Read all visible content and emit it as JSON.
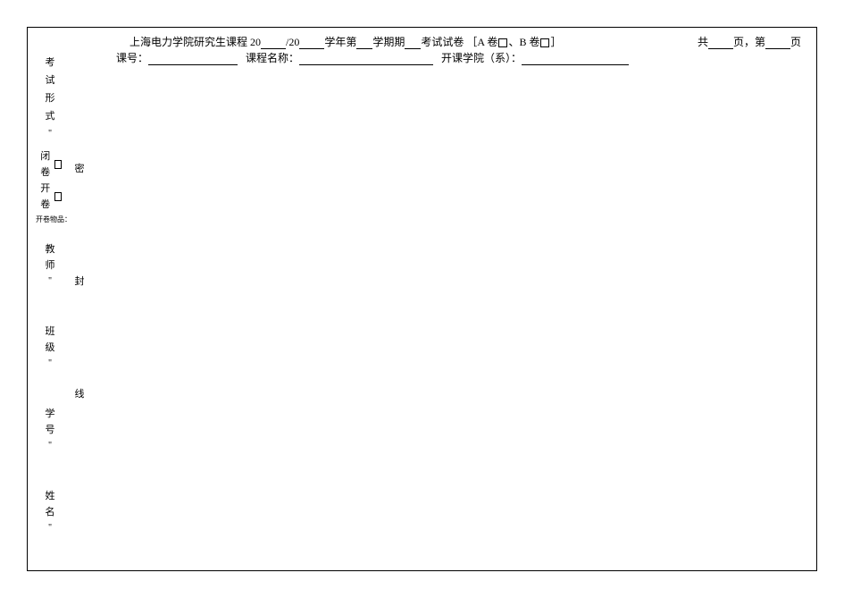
{
  "header": {
    "title_prefix": "上海电力学院研究生课程 20",
    "title_mid1": "/20",
    "title_mid2": "学年第",
    "title_mid3": "学期期",
    "title_suffix": "考试试卷",
    "bracket_open": "［",
    "a_paper": "A 卷",
    "separator": "、",
    "b_paper": "B 卷",
    "bracket_close": "］"
  },
  "page_info": {
    "total_prefix": "共",
    "total_suffix": "页，第",
    "current_suffix": "页"
  },
  "sub_header": {
    "course_no_label": "课号：",
    "course_name_label": "课程名称：",
    "dept_label": "开课学院（系）："
  },
  "left": {
    "exam_form": {
      "c1": "考",
      "c2": "试",
      "c3": "形",
      "c4": "式"
    },
    "closed": "闭卷",
    "open": "开卷",
    "items": "开卷物品：",
    "teacher": {
      "c1": "教",
      "c2": "师"
    },
    "class": {
      "c1": "班",
      "c2": "级"
    },
    "student_no": {
      "c1": "学",
      "c2": "号"
    },
    "name": {
      "c1": "姓",
      "c2": "名"
    }
  },
  "seal": {
    "c1": "密",
    "c2": "封",
    "c3": "线"
  },
  "quote_mark": "\""
}
